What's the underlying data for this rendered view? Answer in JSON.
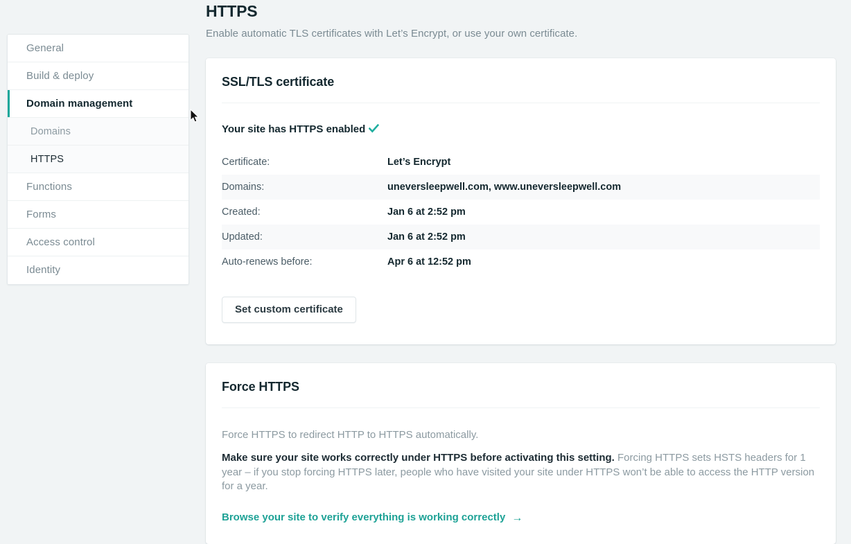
{
  "sidebar": {
    "items": [
      {
        "label": "General",
        "level": "top",
        "state": "default"
      },
      {
        "label": "Build & deploy",
        "level": "top",
        "state": "default"
      },
      {
        "label": "Domain management",
        "level": "top",
        "state": "active"
      },
      {
        "label": "Domains",
        "level": "sub",
        "state": "default"
      },
      {
        "label": "HTTPS",
        "level": "sub",
        "state": "current"
      },
      {
        "label": "Functions",
        "level": "top",
        "state": "default"
      },
      {
        "label": "Forms",
        "level": "top",
        "state": "default"
      },
      {
        "label": "Access control",
        "level": "top",
        "state": "default"
      },
      {
        "label": "Identity",
        "level": "top",
        "state": "default"
      }
    ]
  },
  "header": {
    "title": "HTTPS",
    "subtitle": "Enable automatic TLS certificates with Let’s Encrypt, or use your own certificate."
  },
  "ssl_card": {
    "title": "SSL/TLS certificate",
    "status_text": "Your site has HTTPS enabled",
    "status_icon": "check-icon",
    "rows": [
      {
        "key": "Certificate:",
        "value": "Let’s Encrypt"
      },
      {
        "key": "Domains:",
        "value": "uneversleepwell.com, www.uneversleepwell.com"
      },
      {
        "key": "Created:",
        "value": "Jan 6 at 2:52 pm"
      },
      {
        "key": "Updated:",
        "value": "Jan 6 at 2:52 pm"
      },
      {
        "key": "Auto-renews before:",
        "value": "Apr 6 at 12:52 pm"
      }
    ],
    "button_label": "Set custom certificate"
  },
  "force_card": {
    "title": "Force HTTPS",
    "description": "Force HTTPS to redirect HTTP to HTTPS automatically.",
    "warning_bold": "Make sure your site works correctly under HTTPS before activating this setting.",
    "warning_rest": " Forcing HTTPS sets HSTS headers for 1 year – if you stop forcing HTTPS later, people who have visited your site under HTTPS won’t be able to access the HTTP version for a year.",
    "link_label": "Browse your site to verify everything is working correctly",
    "link_arrow": "→"
  },
  "colors": {
    "accent_teal": "#1ea296",
    "active_bar": "#16a79a",
    "page_bg": "#f1f4f5",
    "card_bg": "#ffffff",
    "muted_text": "#8c9aa1",
    "dark_text": "#14282f"
  }
}
